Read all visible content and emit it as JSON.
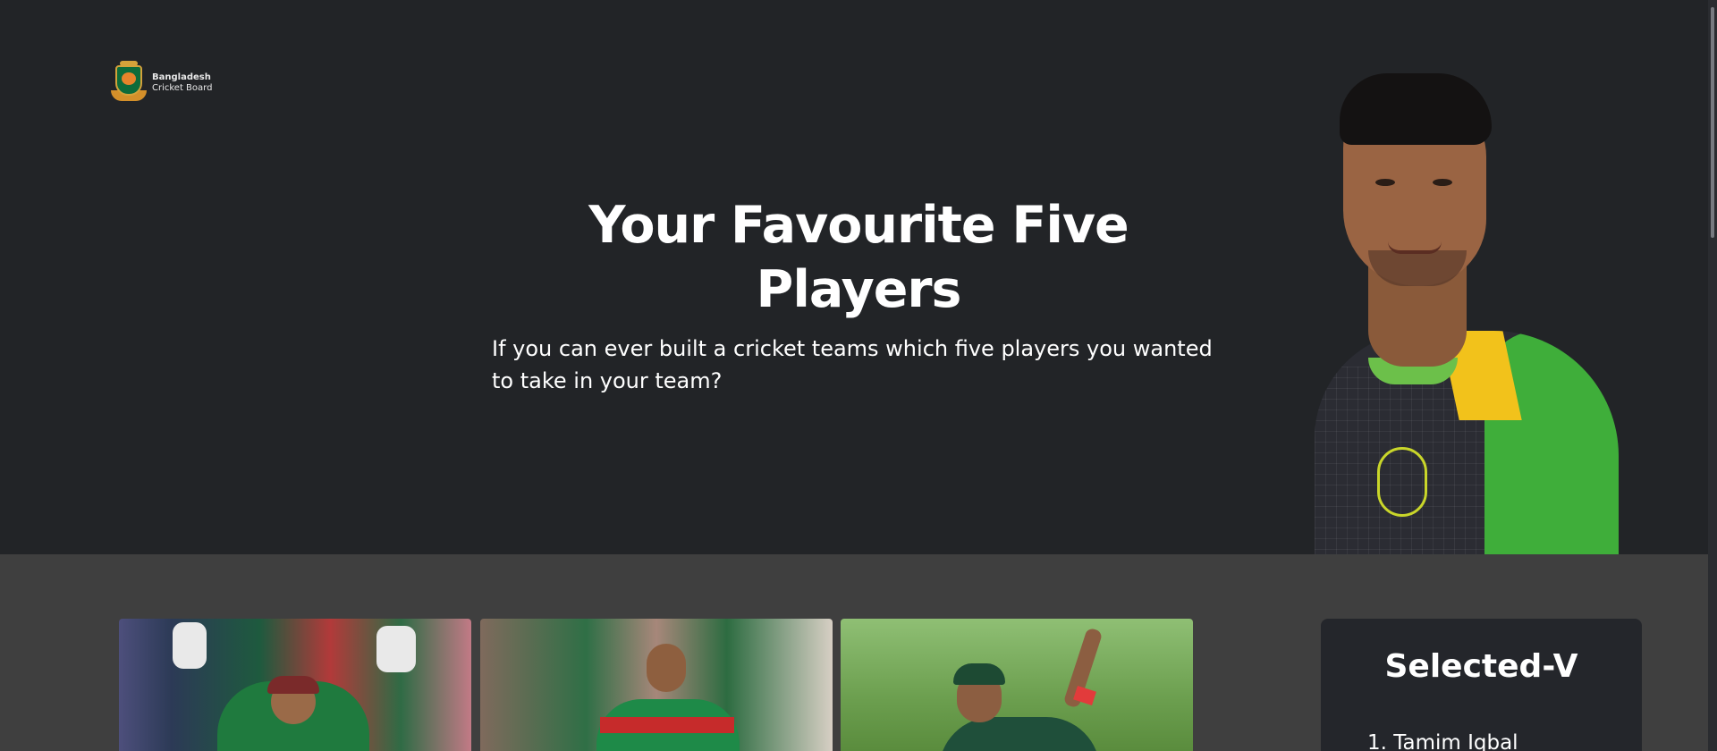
{
  "brand": {
    "logo_line1": "Bangladesh",
    "logo_line2": "Cricket Board",
    "logo_icon": "bcb-crest-icon"
  },
  "hero": {
    "title_line1": "Your Favourite Five",
    "title_line2": "Players",
    "subtitle": "If you can ever built a cricket teams which five players you wanted to take in your team?",
    "portrait_icon": "player-portrait-image"
  },
  "players": [
    {
      "image": "player-card-image-1"
    },
    {
      "image": "player-card-image-2"
    },
    {
      "image": "player-card-image-3"
    }
  ],
  "selected": {
    "title": "Selected-V",
    "items": [
      "1. Tamim Iqbal"
    ]
  },
  "colors": {
    "page_bg": "#222427",
    "lower_bg": "#3f3f3f",
    "panel_bg": "#24262b",
    "text": "#ffffff"
  }
}
